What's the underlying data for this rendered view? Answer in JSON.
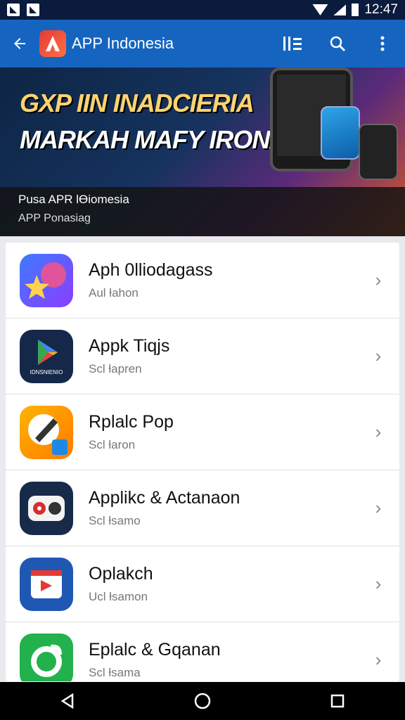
{
  "status_bar": {
    "time": "12:47"
  },
  "toolbar": {
    "title": "APP Indonesia"
  },
  "banner": {
    "headline_line1": "GXP IIN INADCIERIA",
    "headline_line2": "MARKAH MAFY IRONAM",
    "caption_title": "Pusa APR lƟiomesia",
    "caption_subtitle": "APP Ponasiag"
  },
  "apps": [
    {
      "title": "Aph 0lliodagass",
      "subtitle": "Aul ƚahon",
      "icon": "galaxy-store-icon",
      "color": "#6a3de8"
    },
    {
      "title": "Appk Tiqjs",
      "subtitle": "Scl ƚapren",
      "icon": "play-store-icon",
      "color": "#15284a",
      "icon_text": "IDNSNIENIO"
    },
    {
      "title": "Rplalc Pop",
      "subtitle": "Scl ƚaron",
      "icon": "paint-brush-icon",
      "color": "#f39c12"
    },
    {
      "title": "Applikc & Actanaon",
      "subtitle": "Scl ƚsamo",
      "icon": "cassette-icon",
      "color": "#172a4a"
    },
    {
      "title": "Oplakch",
      "subtitle": "Ucl ƚsamon",
      "icon": "video-card-icon",
      "color": "#1f58b3"
    },
    {
      "title": "Eplalc & Gqanan",
      "subtitle": "Scl ƚsama",
      "icon": "chat-leaf-icon",
      "color": "#22b14c"
    }
  ]
}
